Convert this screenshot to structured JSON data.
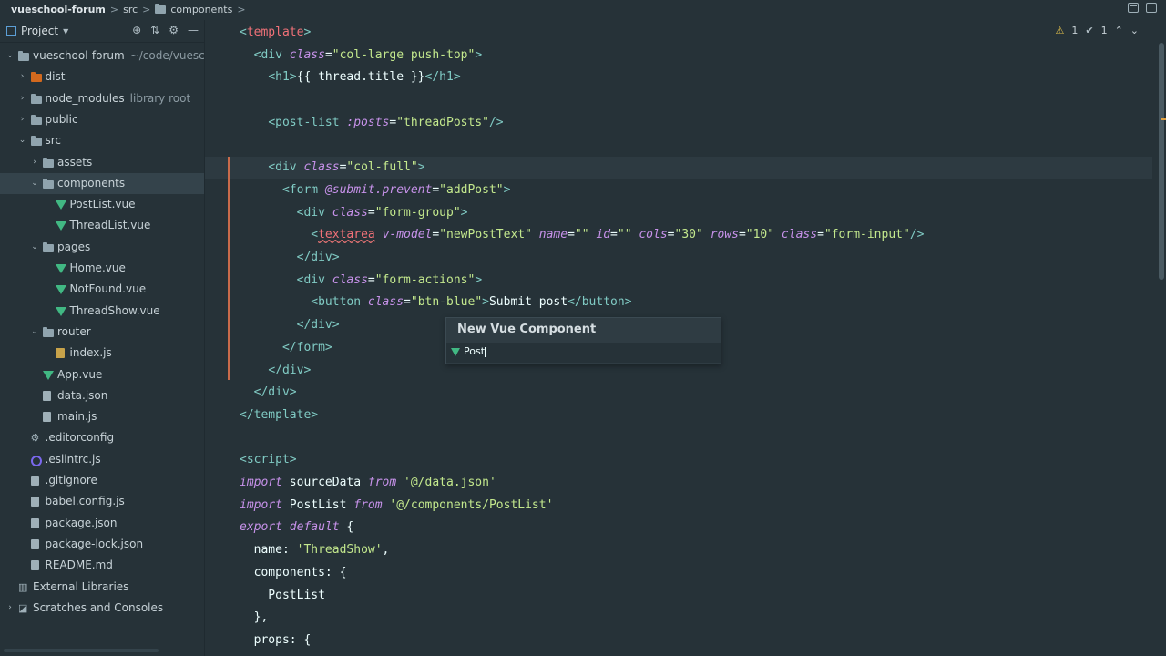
{
  "breadcrumb": {
    "project": "vueschool-forum",
    "src": "src",
    "components": "components",
    "sep": ">"
  },
  "sidebar": {
    "title": "Project",
    "tree": [
      {
        "label": "vueschool-forum",
        "hint": "~/code/vueschool-forum",
        "type": "folder",
        "depth": 0,
        "expanded": true
      },
      {
        "label": "dist",
        "type": "folder-orange",
        "depth": 1,
        "expanded": false
      },
      {
        "label": "node_modules",
        "hint": "library root",
        "type": "folder",
        "depth": 1,
        "expanded": false
      },
      {
        "label": "public",
        "type": "folder",
        "depth": 1,
        "expanded": false
      },
      {
        "label": "src",
        "type": "folder",
        "depth": 1,
        "expanded": true
      },
      {
        "label": "assets",
        "type": "folder",
        "depth": 2,
        "expanded": false
      },
      {
        "label": "components",
        "type": "folder",
        "depth": 2,
        "expanded": true,
        "selected": true
      },
      {
        "label": "PostList.vue",
        "type": "vue",
        "depth": 3
      },
      {
        "label": "ThreadList.vue",
        "type": "vue",
        "depth": 3
      },
      {
        "label": "pages",
        "type": "folder",
        "depth": 2,
        "expanded": true
      },
      {
        "label": "Home.vue",
        "type": "vue",
        "depth": 3
      },
      {
        "label": "NotFound.vue",
        "type": "vue",
        "depth": 3
      },
      {
        "label": "ThreadShow.vue",
        "type": "vue",
        "depth": 3
      },
      {
        "label": "router",
        "type": "folder",
        "depth": 2,
        "expanded": true
      },
      {
        "label": "index.js",
        "type": "js",
        "depth": 3
      },
      {
        "label": "App.vue",
        "type": "vue",
        "depth": 2
      },
      {
        "label": "data.json",
        "type": "file",
        "depth": 2
      },
      {
        "label": "main.js",
        "type": "file",
        "depth": 2
      },
      {
        "label": ".editorconfig",
        "type": "gear",
        "depth": 1
      },
      {
        "label": ".eslintrc.js",
        "type": "circle",
        "depth": 1
      },
      {
        "label": ".gitignore",
        "type": "file",
        "depth": 1
      },
      {
        "label": "babel.config.js",
        "type": "file",
        "depth": 1
      },
      {
        "label": "package.json",
        "type": "file",
        "depth": 1
      },
      {
        "label": "package-lock.json",
        "type": "file",
        "depth": 1
      },
      {
        "label": "README.md",
        "type": "file",
        "depth": 1
      },
      {
        "label": "External Libraries",
        "type": "lib",
        "depth": 0
      },
      {
        "label": "Scratches and Consoles",
        "type": "scratch",
        "depth": 0,
        "expanded": false
      }
    ]
  },
  "inspections": {
    "warnings": "1",
    "weak_warnings": "1"
  },
  "code_lines": [
    [
      [
        "tag",
        "<"
      ],
      [
        "tagname",
        "template"
      ],
      [
        "tag",
        ">"
      ]
    ],
    [
      [
        "plain",
        "  "
      ],
      [
        "tag",
        "<div "
      ],
      [
        "attr",
        "class"
      ],
      [
        "plain",
        "="
      ],
      [
        "str",
        "\"col-large push-top\""
      ],
      [
        "tag",
        ">"
      ]
    ],
    [
      [
        "plain",
        "    "
      ],
      [
        "tag",
        "<h1>"
      ],
      [
        "plain",
        "{{ thread.title }}"
      ],
      [
        "tag",
        "</h1>"
      ]
    ],
    [],
    [
      [
        "plain",
        "    "
      ],
      [
        "tag",
        "<post-list "
      ],
      [
        "attr",
        ":posts"
      ],
      [
        "plain",
        "="
      ],
      [
        "str",
        "\"threadPosts\""
      ],
      [
        "tag",
        "/>"
      ]
    ],
    [],
    [
      [
        "plain",
        "    "
      ],
      [
        "tag",
        "<div "
      ],
      [
        "attr",
        "class"
      ],
      [
        "plain",
        "="
      ],
      [
        "str",
        "\"col-full\""
      ],
      [
        "tag",
        ">"
      ]
    ],
    [
      [
        "plain",
        "      "
      ],
      [
        "tag",
        "<form "
      ],
      [
        "attr",
        "@submit.prevent"
      ],
      [
        "plain",
        "="
      ],
      [
        "str",
        "\"addPost\""
      ],
      [
        "tag",
        ">"
      ]
    ],
    [
      [
        "plain",
        "        "
      ],
      [
        "tag",
        "<div "
      ],
      [
        "attr",
        "class"
      ],
      [
        "plain",
        "="
      ],
      [
        "str",
        "\"form-group\""
      ],
      [
        "tag",
        ">"
      ]
    ],
    [
      [
        "plain",
        "          "
      ],
      [
        "tag",
        "<"
      ],
      [
        "tagsq",
        "textarea"
      ],
      [
        "plain",
        " "
      ],
      [
        "attr",
        "v-model"
      ],
      [
        "plain",
        "="
      ],
      [
        "str",
        "\"newPostText\""
      ],
      [
        "plain",
        " "
      ],
      [
        "attr",
        "name"
      ],
      [
        "plain",
        "="
      ],
      [
        "str",
        "\"\""
      ],
      [
        "plain",
        " "
      ],
      [
        "attr",
        "id"
      ],
      [
        "plain",
        "="
      ],
      [
        "str",
        "\"\""
      ],
      [
        "plain",
        " "
      ],
      [
        "attr",
        "cols"
      ],
      [
        "plain",
        "="
      ],
      [
        "str",
        "\"30\""
      ],
      [
        "plain",
        " "
      ],
      [
        "attr",
        "rows"
      ],
      [
        "plain",
        "="
      ],
      [
        "str",
        "\"10\""
      ],
      [
        "plain",
        " "
      ],
      [
        "attr",
        "class"
      ],
      [
        "plain",
        "="
      ],
      [
        "str",
        "\"form-input\""
      ],
      [
        "tag",
        "/>"
      ]
    ],
    [
      [
        "plain",
        "        "
      ],
      [
        "tag",
        "</div>"
      ]
    ],
    [
      [
        "plain",
        "        "
      ],
      [
        "tag",
        "<div "
      ],
      [
        "attr",
        "class"
      ],
      [
        "plain",
        "="
      ],
      [
        "str",
        "\"form-actions\""
      ],
      [
        "tag",
        ">"
      ]
    ],
    [
      [
        "plain",
        "          "
      ],
      [
        "tag",
        "<button "
      ],
      [
        "attr",
        "class"
      ],
      [
        "plain",
        "="
      ],
      [
        "str",
        "\"btn-blue\""
      ],
      [
        "tag",
        ">"
      ],
      [
        "plain",
        "Submit post"
      ],
      [
        "tag",
        "</button>"
      ]
    ],
    [
      [
        "plain",
        "        "
      ],
      [
        "tag",
        "</div>"
      ]
    ],
    [
      [
        "plain",
        "      "
      ],
      [
        "tag",
        "</form>"
      ]
    ],
    [
      [
        "plain",
        "    "
      ],
      [
        "tag",
        "</div>"
      ]
    ],
    [
      [
        "plain",
        "  "
      ],
      [
        "tag",
        "</div>"
      ]
    ],
    [
      [
        "tag",
        "</template>"
      ]
    ],
    [],
    [
      [
        "tag",
        "<script>"
      ]
    ],
    [
      [
        "kw",
        "import"
      ],
      [
        "plain",
        " sourceData "
      ],
      [
        "kw",
        "from"
      ],
      [
        "plain",
        " "
      ],
      [
        "str",
        "'@/data.json'"
      ]
    ],
    [
      [
        "kw",
        "import"
      ],
      [
        "plain",
        " PostList "
      ],
      [
        "kw",
        "from"
      ],
      [
        "plain",
        " "
      ],
      [
        "str",
        "'@/components/PostList'"
      ]
    ],
    [
      [
        "kw",
        "export"
      ],
      [
        "plain",
        " "
      ],
      [
        "kw",
        "default"
      ],
      [
        "plain",
        " {"
      ]
    ],
    [
      [
        "plain",
        "  name: "
      ],
      [
        "str",
        "'ThreadShow'"
      ],
      [
        "plain",
        ","
      ]
    ],
    [
      [
        "plain",
        "  components: {"
      ]
    ],
    [
      [
        "plain",
        "    PostList"
      ]
    ],
    [
      [
        "plain",
        "  },"
      ]
    ],
    [
      [
        "plain",
        "  props: {"
      ]
    ]
  ],
  "popup": {
    "title": "New Vue Component",
    "input": "Post"
  }
}
